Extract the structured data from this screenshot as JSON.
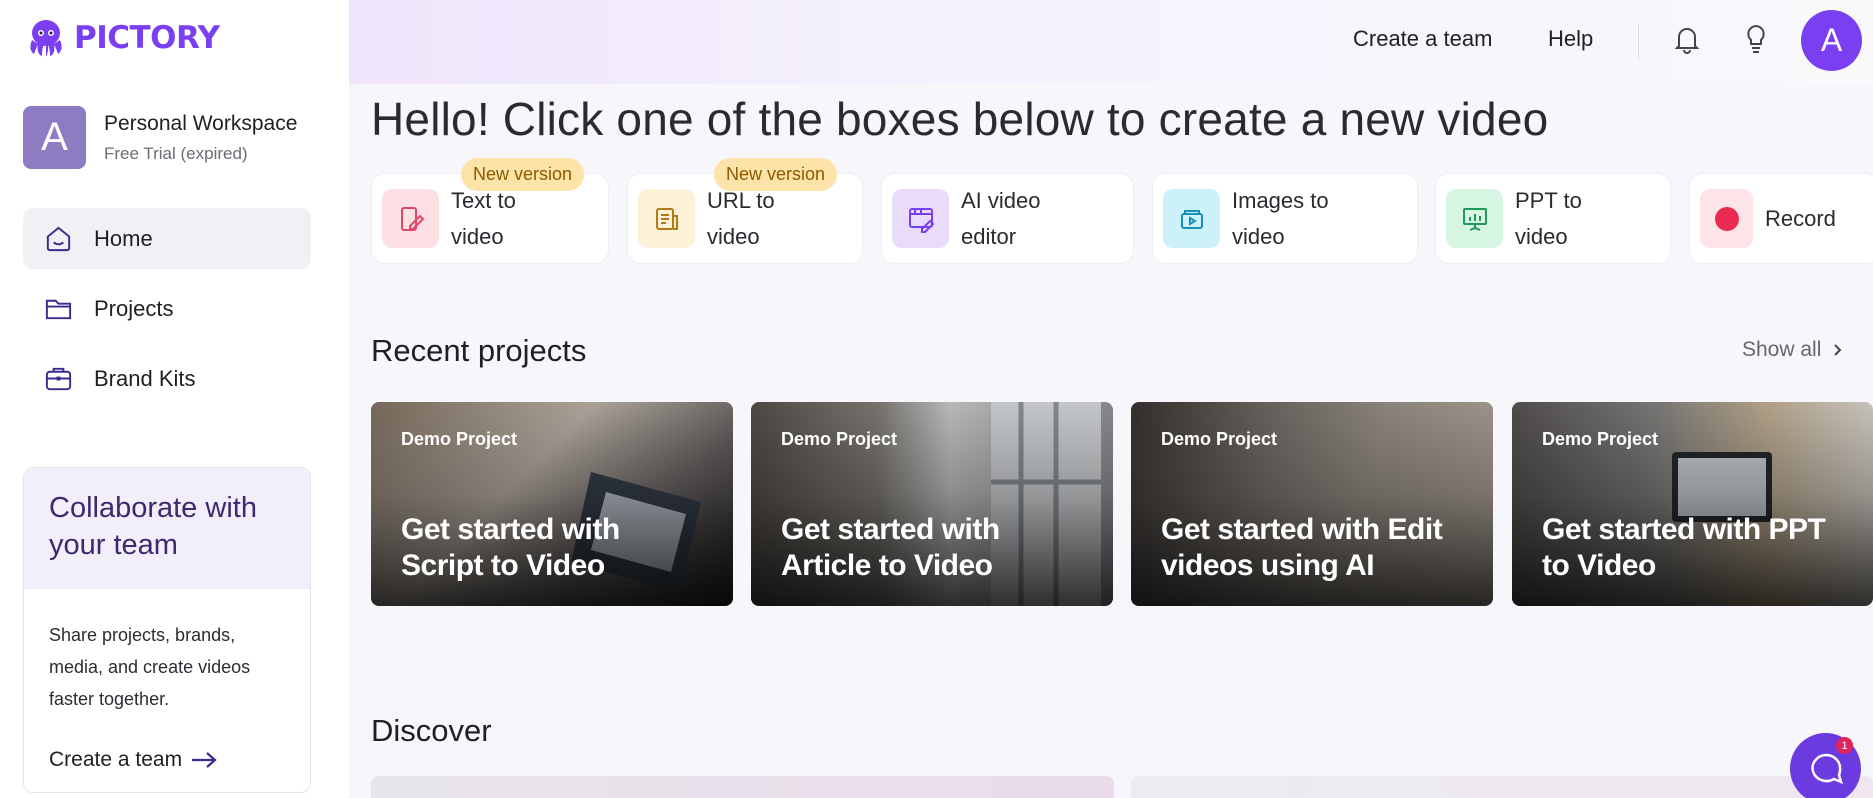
{
  "brand": {
    "name": "PICTORY",
    "color": "#7b3ff2"
  },
  "workspace": {
    "avatar_letter": "A",
    "name": "Personal Workspace",
    "status": "Free Trial (expired)"
  },
  "nav": [
    {
      "label": "Home",
      "icon": "home-icon",
      "active": true
    },
    {
      "label": "Projects",
      "icon": "folder-icon",
      "active": false
    },
    {
      "label": "Brand Kits",
      "icon": "briefcase-icon",
      "active": false
    }
  ],
  "collab": {
    "title": "Collaborate with your team",
    "body": "Share projects, brands, media, and create videos faster together.",
    "cta": "Create a team"
  },
  "header": {
    "create_team": "Create a team",
    "help": "Help",
    "avatar_letter": "A"
  },
  "greeting": "Hello! Click one of the boxes below to create a new video",
  "create_options": [
    {
      "label": "Text to\nvideo",
      "badge": "New version",
      "icon": "text-to-video-icon"
    },
    {
      "label": "URL to\nvideo",
      "badge": "New version",
      "icon": "url-to-video-icon"
    },
    {
      "label": "AI video\neditor",
      "icon": "ai-video-editor-icon"
    },
    {
      "label": "Images to\nvideo",
      "icon": "images-to-video-icon"
    },
    {
      "label": "PPT to\nvideo",
      "icon": "ppt-to-video-icon"
    },
    {
      "label": "Record",
      "icon": "record-icon"
    }
  ],
  "recent": {
    "title": "Recent projects",
    "show_all": "Show all",
    "projects": [
      {
        "tag": "Demo Project",
        "title": "Get started with Script to Video"
      },
      {
        "tag": "Demo Project",
        "title": "Get started with Article to Video"
      },
      {
        "tag": "Demo Project",
        "title": "Get started with Edit videos using AI"
      },
      {
        "tag": "Demo Project",
        "title": "Get started with PPT to Video"
      }
    ]
  },
  "discover": {
    "title": "Discover"
  },
  "chat": {
    "unread": "1"
  }
}
